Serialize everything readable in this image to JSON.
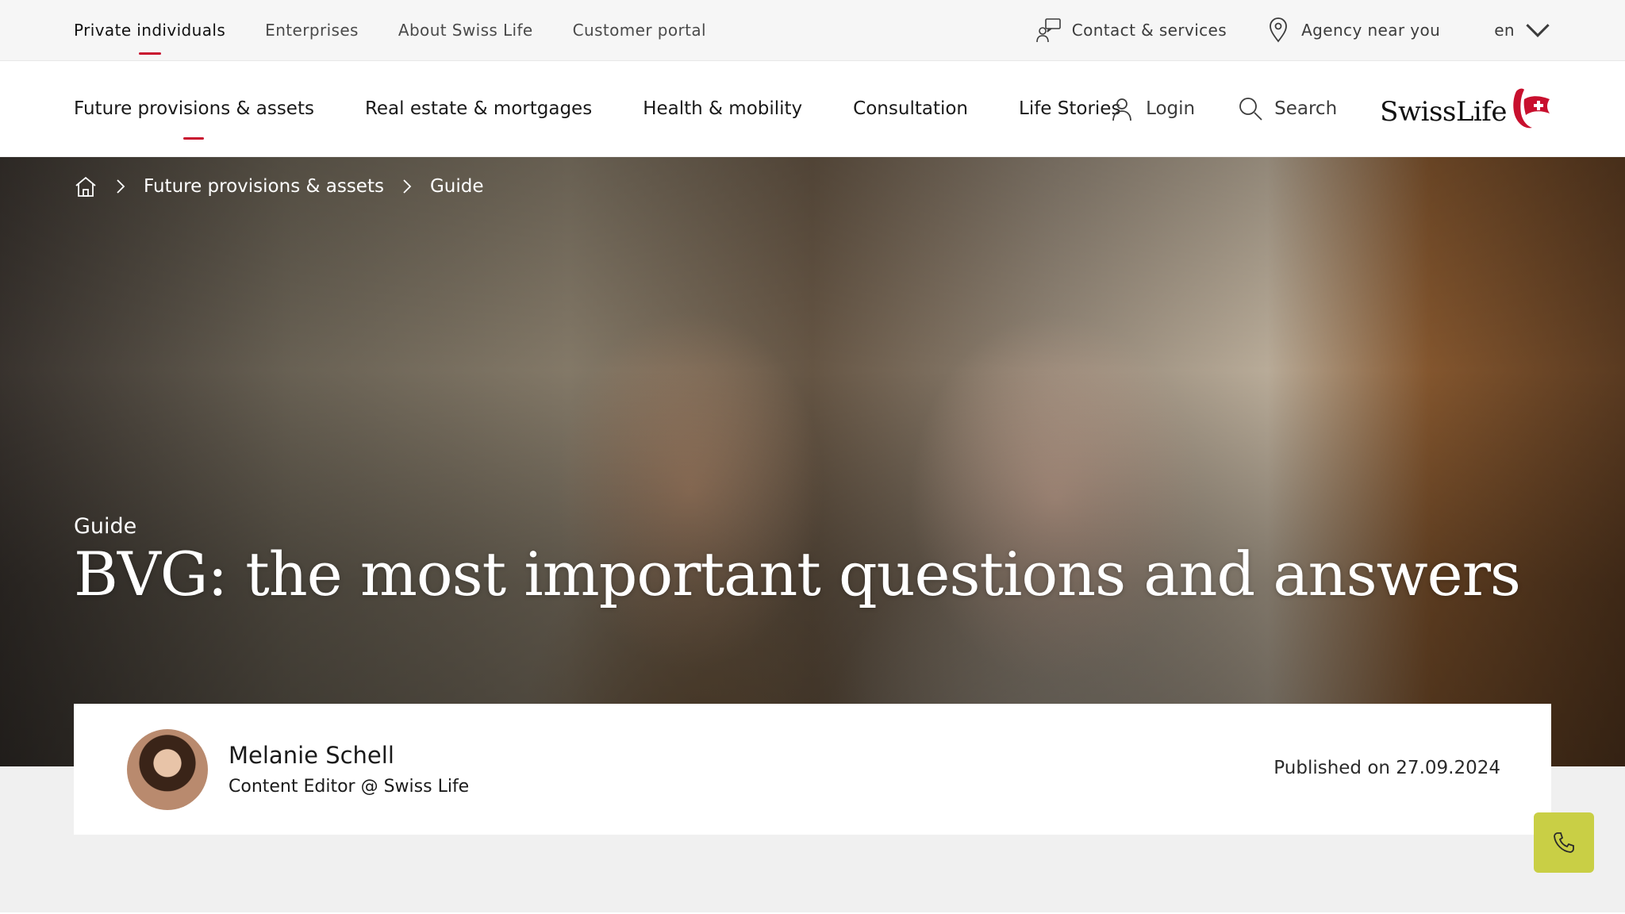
{
  "topbar": {
    "links": [
      "Private individuals",
      "Enterprises",
      "About Swiss Life",
      "Customer portal"
    ],
    "contact_label": "Contact & services",
    "agency_label": "Agency near you",
    "language": "en"
  },
  "nav": {
    "items": [
      "Future provisions & assets",
      "Real estate & mortgages",
      "Health & mobility",
      "Consultation",
      "Life Stories"
    ],
    "login_label": "Login",
    "search_label": "Search",
    "logo_text": "SwissLife"
  },
  "hero": {
    "breadcrumb": [
      "Future provisions & assets",
      "Guide"
    ],
    "eyebrow": "Guide",
    "title": "BVG: the most important questions and answers"
  },
  "author": {
    "name": "Melanie Schell",
    "role": "Content Editor @ Swiss Life",
    "published": "Published on 27.09.2024"
  },
  "colors": {
    "accent_red": "#c8102e",
    "call_button": "#c9cf45"
  }
}
